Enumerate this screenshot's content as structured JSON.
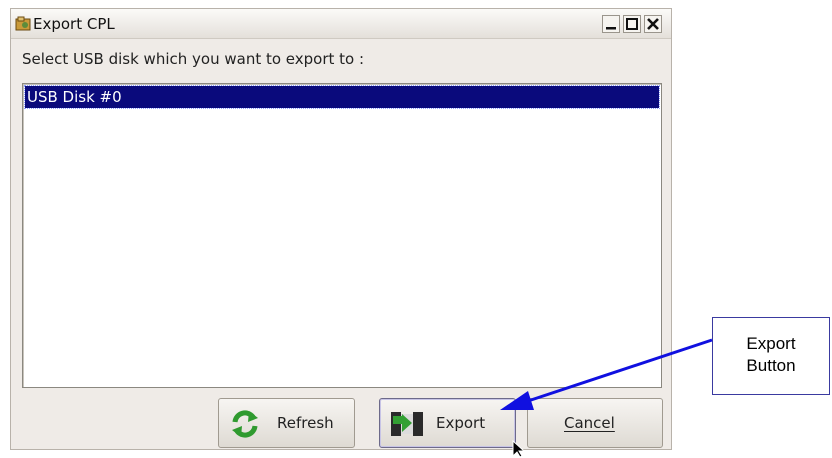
{
  "window": {
    "title": "Export CPL",
    "controls": {
      "minimize": "minimize",
      "maximize": "maximize",
      "close": "close"
    }
  },
  "prompt": "Select USB disk which you want to export to :",
  "list": {
    "items": [
      {
        "label": "USB Disk #0",
        "selected": true
      }
    ]
  },
  "buttons": {
    "refresh": {
      "label": "Refresh",
      "icon": "refresh-icon"
    },
    "export": {
      "label": "Export",
      "icon": "export-disk-icon"
    },
    "cancel": {
      "label": "Cancel",
      "mnemonic": "C"
    }
  },
  "annotation": {
    "line1": "Export",
    "line2": "Button"
  },
  "colors": {
    "selection": "#0a0a7c",
    "window_bg": "#efebe7",
    "arrow": "#1010e0"
  }
}
